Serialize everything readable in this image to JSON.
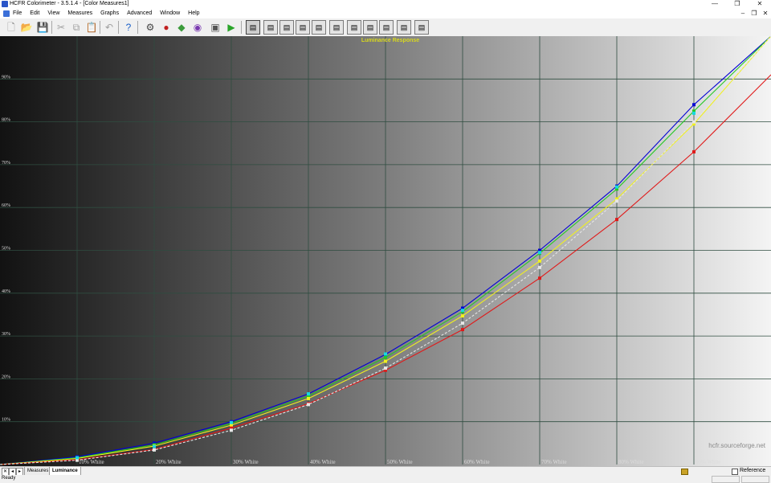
{
  "window": {
    "title": "HCFR Colorimeter - 3.5.1.4 - [Color Measures1]",
    "minimize": "—",
    "maximize": "❐",
    "close": "✕"
  },
  "menu": {
    "items": [
      "File",
      "Edit",
      "View",
      "Measures",
      "Graphs",
      "Advanced",
      "Window",
      "Help"
    ]
  },
  "mdi": {
    "minimize": "–",
    "restore": "❐",
    "close": "✕"
  },
  "toolbar": {
    "icons": [
      "new-icon",
      "open-icon",
      "save-icon",
      "cut-icon",
      "copy-icon",
      "paste-icon",
      "undo-icon",
      "help-icon",
      "sensor-icon",
      "rgb-icon",
      "color-gen-icon",
      "palette-icon",
      "camera-icon",
      "play-icon"
    ],
    "graph_icons": [
      "luminance-graph-icon",
      "gamma-graph-icon",
      "rgb-levels-graph-icon",
      "cie-graph-icon",
      "delta-e-graph-icon",
      "saturation-luminance-graph-icon",
      "color-temp-graph-icon",
      "near-black-graph-icon",
      "near-white-graph-icon",
      "free-measures-graph-icon",
      "measures-graph-icon"
    ]
  },
  "tabs": {
    "measures": "Measures",
    "luminance": "Luminance"
  },
  "reference": {
    "label": "Reference",
    "checked": false
  },
  "status": {
    "text": "Ready"
  },
  "watermark": "hcfr.sourceforge.net",
  "colors": {
    "title": "#d8d81e",
    "grid": "#2f4d40",
    "blue": "#0000d4",
    "green": "#26c826",
    "yellow": "#f0f020",
    "red": "#e01a1a",
    "cyan": "#18d8e0",
    "reference": "#e6e6e6"
  },
  "chart_data": {
    "type": "line",
    "title": "Luminance Response",
    "x": [
      0,
      10,
      20,
      30,
      40,
      50,
      60,
      70,
      80,
      90,
      100
    ],
    "x_tick_labels": [
      "",
      "10% White",
      "20% White",
      "30% White",
      "40% White",
      "50% White",
      "60% White",
      "70% White",
      "80% White",
      "90% White",
      ""
    ],
    "y_tick_labels": [
      "10%",
      "20%",
      "30%",
      "40%",
      "50%",
      "60%",
      "70%",
      "80%",
      "90%"
    ],
    "y_ticks": [
      10,
      20,
      30,
      40,
      50,
      60,
      70,
      80,
      90
    ],
    "xlim": [
      0,
      100
    ],
    "ylim": [
      0,
      100
    ],
    "grid": true,
    "series": [
      {
        "color": "#0000d4",
        "values": [
          0,
          1.8,
          5.0,
          10.0,
          16.5,
          25.7,
          36.5,
          50.0,
          65.0,
          84.0,
          100
        ]
      },
      {
        "color": "#26c826",
        "values": [
          0,
          1.6,
          4.6,
          9.6,
          16.0,
          25.0,
          35.7,
          49.3,
          64.3,
          82.5,
          100
        ]
      },
      {
        "color": "#f0f020",
        "values": [
          0,
          1.4,
          4.3,
          9.2,
          15.4,
          24.1,
          34.7,
          47.5,
          62.0,
          79.5,
          100
        ]
      },
      {
        "color": "#e01a1a",
        "values": [
          0,
          1.1,
          3.5,
          8.5,
          14.2,
          22.0,
          31.5,
          43.5,
          57.2,
          73.0,
          91.0
        ]
      },
      {
        "color": "#e6e6e6",
        "dashed": true,
        "values": [
          0,
          1.0,
          3.4,
          8.0,
          14.0,
          22.5,
          33.0,
          46.0,
          61.5,
          80.0,
          100
        ]
      }
    ],
    "extra_markers": [
      {
        "color": "#18d8e0",
        "values": [
          null,
          1.6,
          4.2,
          9.8,
          16.5,
          25.8,
          36.0,
          49.5,
          64.8,
          82.0,
          null
        ]
      }
    ]
  }
}
